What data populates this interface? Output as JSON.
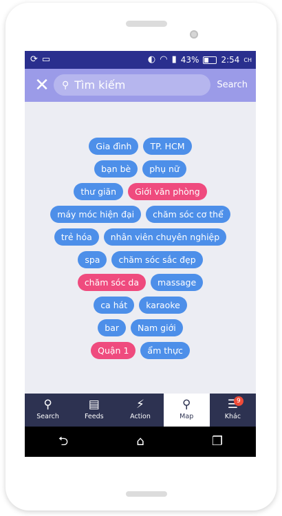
{
  "status_bar": {
    "battery": "43%",
    "time": "2:54",
    "carrier": "CH"
  },
  "search": {
    "placeholder": "Tìm kiếm",
    "action_label": "Search"
  },
  "tags": [
    [
      {
        "label": "Gia đình",
        "active": false
      },
      {
        "label": "TP. HCM",
        "active": false
      }
    ],
    [
      {
        "label": "bạn bè",
        "active": false
      },
      {
        "label": "phụ nữ",
        "active": false
      }
    ],
    [
      {
        "label": "thư giãn",
        "active": false
      },
      {
        "label": "Giới văn phòng",
        "active": true
      }
    ],
    [
      {
        "label": "máy móc hiện đại",
        "active": false
      },
      {
        "label": "chăm sóc cơ thể",
        "active": false
      }
    ],
    [
      {
        "label": "trẻ hóa",
        "active": false
      },
      {
        "label": "nhân viên chuyên nghiệp",
        "active": false
      }
    ],
    [
      {
        "label": "spa",
        "active": false
      },
      {
        "label": "chăm sóc sắc đẹp",
        "active": false
      }
    ],
    [
      {
        "label": "chăm sóc da",
        "active": true
      },
      {
        "label": "massage",
        "active": false
      }
    ],
    [
      {
        "label": "ca hát",
        "active": false
      },
      {
        "label": "karaoke",
        "active": false
      }
    ],
    [
      {
        "label": "bar",
        "active": false
      },
      {
        "label": "Nam giới",
        "active": false
      }
    ],
    [
      {
        "label": "Quận 1",
        "active": true
      },
      {
        "label": "ẩm thực",
        "active": false
      }
    ]
  ],
  "bottom_nav": [
    {
      "label": "Search",
      "icon": "search-icon",
      "active": false
    },
    {
      "label": "Feeds",
      "icon": "feeds-icon",
      "active": false
    },
    {
      "label": "Action",
      "icon": "action-icon",
      "active": false
    },
    {
      "label": "Map",
      "icon": "map-pin-icon",
      "active": true
    },
    {
      "label": "Khác",
      "icon": "menu-icon",
      "active": false,
      "badge": "9"
    }
  ],
  "colors": {
    "status_bar": "#2a2f8e",
    "search_bar": "#9b9be8",
    "tag_default": "#4d8fe9",
    "tag_active": "#ef4b7e",
    "bottom_nav": "#2d3251"
  }
}
